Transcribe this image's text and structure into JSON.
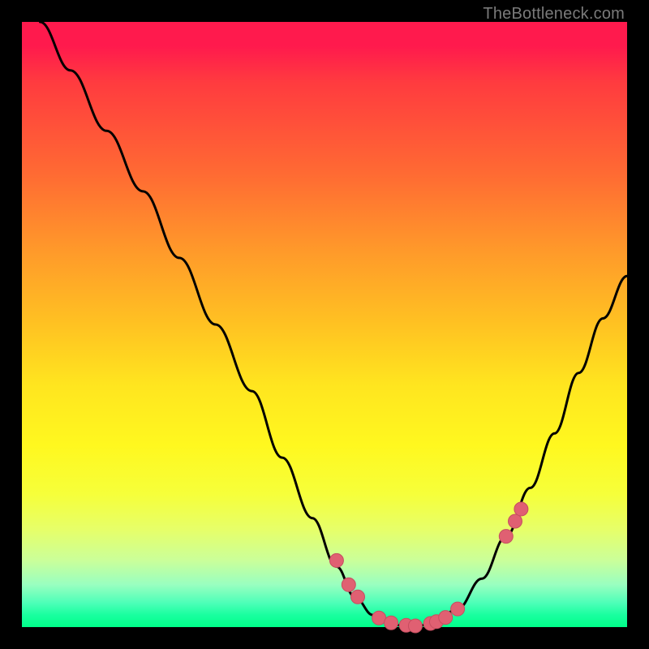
{
  "watermark": "TheBottleneck.com",
  "colors": {
    "frame": "#000000",
    "curve": "#000000",
    "marker_fill": "#e06072",
    "marker_stroke": "#c64e60"
  },
  "chart_data": {
    "type": "line",
    "title": "",
    "xlabel": "",
    "ylabel": "",
    "xlim": [
      0,
      100
    ],
    "ylim": [
      0,
      100
    ],
    "series": [
      {
        "name": "curve",
        "x": [
          3,
          8,
          14,
          20,
          26,
          32,
          38,
          43,
          48,
          52,
          55,
          58,
          61,
          64,
          68,
          72,
          76,
          80,
          84,
          88,
          92,
          96,
          100
        ],
        "y": [
          100,
          92,
          82,
          72,
          61,
          50,
          39,
          28,
          18,
          10,
          5,
          2,
          0.5,
          0,
          0.5,
          3,
          8,
          15,
          23,
          32,
          42,
          51,
          58
        ]
      }
    ],
    "markers": {
      "name": "highlighted-points",
      "x": [
        52,
        54,
        55.5,
        59,
        61,
        63.5,
        65,
        67.5,
        68.5,
        70,
        72,
        80,
        81.5,
        82.5
      ],
      "y": [
        11,
        7,
        5,
        1.5,
        0.7,
        0.3,
        0.2,
        0.6,
        0.9,
        1.6,
        3,
        15,
        17.5,
        19.5
      ]
    }
  }
}
